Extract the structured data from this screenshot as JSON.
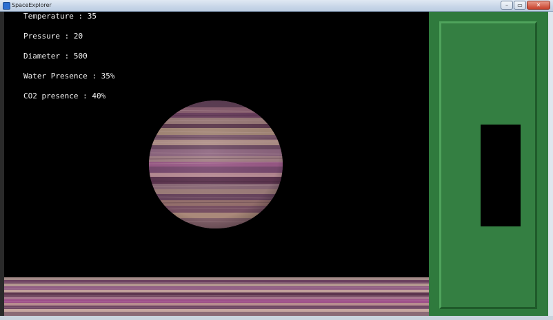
{
  "window": {
    "title": "SpaceExplorer",
    "buttons": {
      "minimize": "–",
      "maximize": "▭",
      "close": "✕"
    }
  },
  "stats": [
    {
      "label": "Temperature",
      "value": "35"
    },
    {
      "label": "Pressure",
      "value": "20"
    },
    {
      "label": "Diameter",
      "value": "500"
    },
    {
      "label": "Water Presence",
      "value": "35%"
    },
    {
      "label": "CO2 presence",
      "value": "40%"
    }
  ],
  "stat_lines": [
    "Temperature : 35",
    "Pressure : 20",
    "Diameter : 500",
    "Water Presence : 35%",
    "CO2 presence : 40%"
  ],
  "colors": {
    "background": "#000000",
    "panel_green": "#2f7a3d",
    "planet_purple": "#7a4a6e",
    "planet_tan": "#b08a7a",
    "text": "#f2f2f2"
  }
}
